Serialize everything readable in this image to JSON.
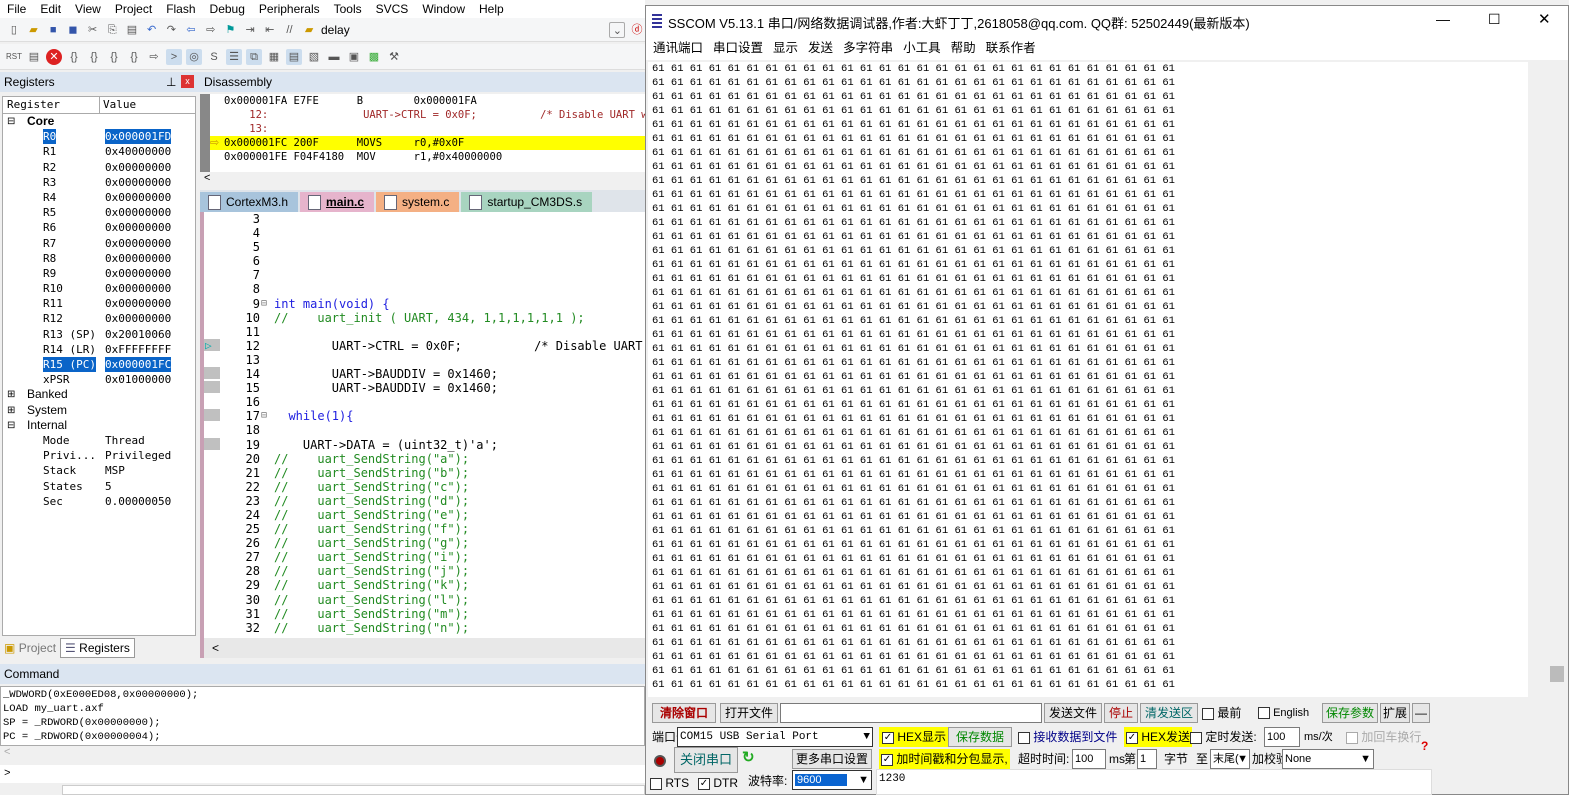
{
  "keil": {
    "menu": [
      "File",
      "Edit",
      "View",
      "Project",
      "Flash",
      "Debug",
      "Peripherals",
      "Tools",
      "SVCS",
      "Window",
      "Help"
    ],
    "toolbar_target": "delay",
    "registers": {
      "title": "Registers",
      "col_register": "Register",
      "col_value": "Value",
      "rows": [
        {
          "name": "Core",
          "value": "",
          "type": "grp"
        },
        {
          "name": "R0",
          "value": "0x000001FD",
          "sel": true
        },
        {
          "name": "R1",
          "value": "0x40000000"
        },
        {
          "name": "R2",
          "value": "0x00000000"
        },
        {
          "name": "R3",
          "value": "0x00000000"
        },
        {
          "name": "R4",
          "value": "0x00000000"
        },
        {
          "name": "R5",
          "value": "0x00000000"
        },
        {
          "name": "R6",
          "value": "0x00000000"
        },
        {
          "name": "R7",
          "value": "0x00000000"
        },
        {
          "name": "R8",
          "value": "0x00000000"
        },
        {
          "name": "R9",
          "value": "0x00000000"
        },
        {
          "name": "R10",
          "value": "0x00000000"
        },
        {
          "name": "R11",
          "value": "0x00000000"
        },
        {
          "name": "R12",
          "value": "0x00000000"
        },
        {
          "name": "R13 (SP)",
          "value": "0x20010060"
        },
        {
          "name": "R14 (LR)",
          "value": "0xFFFFFFFF"
        },
        {
          "name": "R15 (PC)",
          "value": "0x000001FC",
          "sel": true
        },
        {
          "name": "xPSR",
          "value": "0x01000000"
        },
        {
          "name": "Banked",
          "value": "",
          "type": "grp"
        },
        {
          "name": "System",
          "value": "",
          "type": "grp"
        },
        {
          "name": "Internal",
          "value": "",
          "type": "grp"
        },
        {
          "name": "Mode",
          "value": "Thread"
        },
        {
          "name": "Privi...",
          "value": "Privileged"
        },
        {
          "name": "Stack",
          "value": "MSP"
        },
        {
          "name": "States",
          "value": "5"
        },
        {
          "name": "Sec",
          "value": "0.00000050"
        }
      ],
      "tab_project": "Project",
      "tab_registers": "Registers"
    },
    "disassembly": {
      "title": "Disassembly",
      "rows": [
        {
          "text": "0x000001FA E7FE      B        0x000001FA",
          "kind": "asm"
        },
        {
          "text": "    12:               UART->CTRL = 0x0F;          /* Disable UART w",
          "kind": "src"
        },
        {
          "text": "    13:",
          "kind": "src"
        },
        {
          "text": "0x000001FC 200F      MOVS     r0,#0x0F",
          "kind": "cur"
        },
        {
          "text": "0x000001FE F04F4180  MOV      r1,#0x40000000",
          "kind": "asm"
        }
      ]
    },
    "tabs": [
      "CortexM3.h",
      "main.c",
      "system.c",
      "startup_CM3DS.s"
    ],
    "tab_colors": [
      "#a8c4dc",
      "#e6b4cc",
      "#f4b084",
      "#a8d4c0"
    ],
    "code": [
      {
        "n": "3",
        "t": ""
      },
      {
        "n": "4",
        "t": ""
      },
      {
        "n": "5",
        "t": ""
      },
      {
        "n": "6",
        "t": ""
      },
      {
        "n": "7",
        "t": ""
      },
      {
        "n": "8",
        "t": ""
      },
      {
        "n": "9",
        "t": "int main(void) {"
      },
      {
        "n": "10",
        "t": "//    uart_init ( UART, 434, 1,1,1,1,1,1 );",
        "c": true
      },
      {
        "n": "11",
        "t": ""
      },
      {
        "n": "12",
        "t": "        UART->CTRL = 0x0F;          /* Disable UART"
      },
      {
        "n": "13",
        "t": ""
      },
      {
        "n": "14",
        "t": "        UART->BAUDDIV = 0x1460;"
      },
      {
        "n": "15",
        "t": "        UART->BAUDDIV = 0x1460;"
      },
      {
        "n": "16",
        "t": ""
      },
      {
        "n": "17",
        "t": "  while(1){"
      },
      {
        "n": "18",
        "t": ""
      },
      {
        "n": "19",
        "t": "    UART->DATA = (uint32_t)'a';"
      },
      {
        "n": "20",
        "t": "//    uart_SendString(\"a\");",
        "c": true
      },
      {
        "n": "21",
        "t": "//    uart_SendString(\"b\");",
        "c": true
      },
      {
        "n": "22",
        "t": "//    uart_SendString(\"c\");",
        "c": true
      },
      {
        "n": "23",
        "t": "//    uart_SendString(\"d\");",
        "c": true
      },
      {
        "n": "24",
        "t": "//    uart_SendString(\"e\");",
        "c": true
      },
      {
        "n": "25",
        "t": "//    uart_SendString(\"f\");",
        "c": true
      },
      {
        "n": "26",
        "t": "//    uart_SendString(\"g\");",
        "c": true
      },
      {
        "n": "27",
        "t": "//    uart_SendString(\"i\");",
        "c": true
      },
      {
        "n": "28",
        "t": "//    uart_SendString(\"j\");",
        "c": true
      },
      {
        "n": "29",
        "t": "//    uart_SendString(\"k\");",
        "c": true
      },
      {
        "n": "30",
        "t": "//    uart_SendString(\"l\");",
        "c": true
      },
      {
        "n": "31",
        "t": "//    uart_SendString(\"m\");",
        "c": true
      },
      {
        "n": "32",
        "t": "//    uart_SendString(\"n\");",
        "c": true
      }
    ],
    "command": {
      "title": "Command",
      "lines": [
        "_WDWORD(0xE000ED08,0x00000000);",
        "LOAD my_uart.axf",
        "SP = _RDWORD(0x00000000);",
        "PC = _RDWORD(0x00000004);"
      ],
      "prompt": ">"
    }
  },
  "sscom": {
    "title": "SSCOM V5.13.1 串口/网络数据调试器,作者:大虾丁丁,2618058@qq.com. QQ群: 52502449(最新版本)",
    "menu": [
      "通讯端口",
      "串口设置",
      "显示",
      "发送",
      "多字符串",
      "小工具",
      "帮助",
      "联系作者"
    ],
    "rx_byte": "61",
    "clear_window": "清除窗口",
    "open_file": "打开文件",
    "file_path": "",
    "send_file": "发送文件",
    "stop": "停止",
    "clear_send": "清发送区",
    "topmost": "最前",
    "english": "English",
    "save_params": "保存参数",
    "expand": "扩展",
    "collapse": "—",
    "port_label": "端口号",
    "port_value": "COM15 USB Serial Port",
    "hex_display": "HEX显示",
    "save_data": "保存数据",
    "recv_to_file": "接收数据到文件",
    "hex_send": "HEX发送",
    "timed_send": "定时发送:",
    "interval": "100",
    "interval_unit": "ms/次",
    "add_crlf": "加回车换行",
    "close_port": "关闭串口",
    "more_settings": "更多串口设置",
    "timestamp": "加时间戳和分包显示,",
    "timeout_label": "超时时间:",
    "timeout": "100",
    "ms": "ms",
    "byte_from_label": "第",
    "byte_from": "1",
    "byte_unit": "字节",
    "to": "至",
    "to_value": "末尾(",
    "checksum_label": "加校验",
    "checksum": "None",
    "rts": "RTS",
    "dtr": "DTR",
    "baud_label": "波特率:",
    "baud": "9600",
    "send_text": "1230"
  }
}
